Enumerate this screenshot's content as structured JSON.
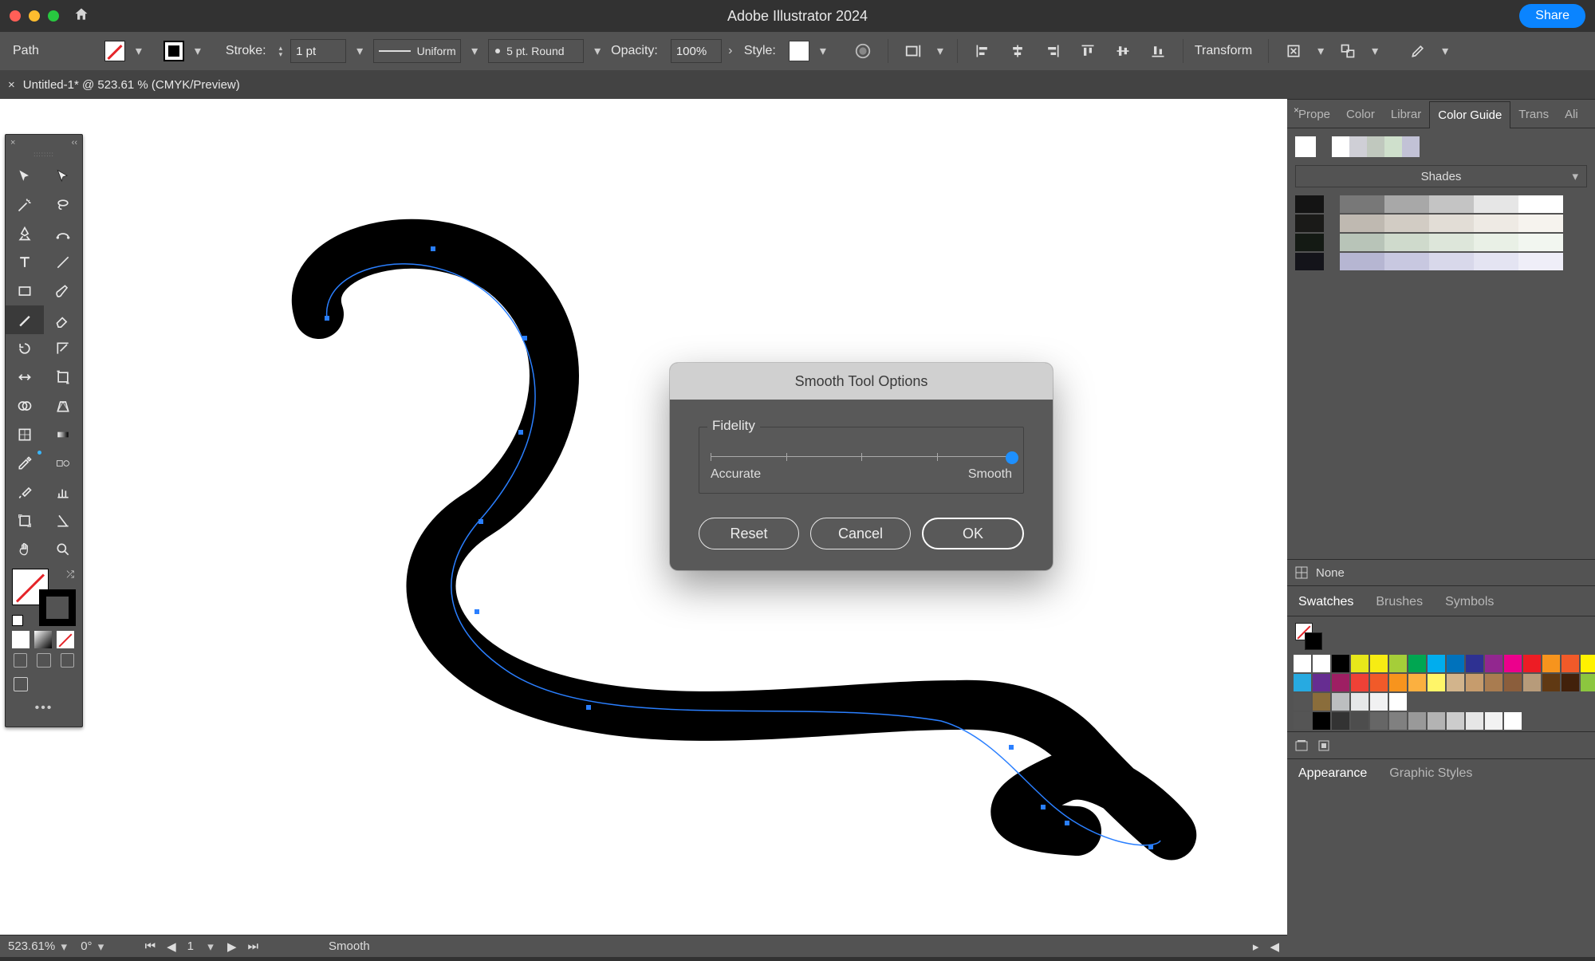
{
  "app": {
    "title": "Adobe Illustrator 2024",
    "share": "Share"
  },
  "selection_label": "Path",
  "control_bar": {
    "stroke_label": "Stroke:",
    "stroke_weight": "1 pt",
    "profile": "Uniform",
    "brush": "5 pt. Round",
    "opacity_label": "Opacity:",
    "opacity_value": "100%",
    "style_label": "Style:",
    "transform": "Transform"
  },
  "document_tab": "Untitled-1* @ 523.61 % (CMYK/Preview)",
  "dialog": {
    "title": "Smooth Tool Options",
    "section": "Fidelity",
    "slider_min_label": "Accurate",
    "slider_max_label": "Smooth",
    "slider_value_percent": 100,
    "reset": "Reset",
    "cancel": "Cancel",
    "ok": "OK"
  },
  "right_panels": {
    "group1_tabs": [
      "Prope",
      "Color",
      "Librar",
      "Color Guide",
      "Trans",
      "Ali"
    ],
    "group1_active": 3,
    "color_guide": {
      "mode": "Shades",
      "none_label": "None",
      "ramp": [
        "#ffffff",
        "#cfcfd6",
        "#c0c8be",
        "#cfe0cc",
        "#c2c2d6"
      ],
      "rows": [
        {
          "left": "#141414",
          "cells": [
            "#787878",
            "#a8a8a8",
            "#c4c4c4",
            "#e6e6e6",
            "#ffffff"
          ]
        },
        {
          "left": "#1a1a18",
          "cells": [
            "#bfb9b1",
            "#d2ccc4",
            "#e2ddd6",
            "#eeeae4",
            "#f6f3ee"
          ]
        },
        {
          "left": "#141a14",
          "cells": [
            "#b8c4b8",
            "#cfdacc",
            "#dde6da",
            "#e9f0e6",
            "#f2f6f0"
          ]
        },
        {
          "left": "#14141a",
          "cells": [
            "#b6b6d2",
            "#c8c8e0",
            "#d8d8ea",
            "#e4e4f2",
            "#efeef8"
          ]
        }
      ]
    },
    "group2_tabs": [
      "Swatches",
      "Brushes",
      "Symbols"
    ],
    "group2_active": 0,
    "group3_tabs": [
      "Appearance",
      "Graphic Styles"
    ],
    "group3_active": 0,
    "swatch_rows": [
      [
        "#ffffff",
        "#ffffff",
        "#000000",
        "#e7e71a",
        "#f7ec13",
        "#a5ce39",
        "#00a651",
        "#00adee",
        "#0072bc",
        "#2e3192",
        "#92278f",
        "#ec008c",
        "#ed1c24",
        "#f7941d",
        "#f15a29",
        "#fff200",
        "#d7df23"
      ],
      [
        "#27aae1",
        "#662d91",
        "#9e1f63",
        "#ef4136",
        "#f15a29",
        "#f7941d",
        "#fbb040",
        "#fff568",
        "#d2b48c",
        "#c69c6d",
        "#a97c50",
        "#8b5e3c",
        "#b79b7a",
        "#603913",
        "#42210b",
        "#8cc63f",
        "#006838"
      ],
      [
        "#555555",
        "#8a6d3b",
        "#bcbec0",
        "#e6e7e8",
        "#f1f1f2",
        "#ffffff"
      ],
      [
        "#555555",
        "#000000",
        "#333333",
        "#4d4d4d",
        "#666666",
        "#808080",
        "#999999",
        "#b3b3b3",
        "#cccccc",
        "#e6e6e6",
        "#f2f2f2",
        "#ffffff"
      ]
    ]
  },
  "statusbar": {
    "zoom": "523.61%",
    "rotate": "0°",
    "artboard_nav": "1",
    "tool": "Smooth"
  }
}
